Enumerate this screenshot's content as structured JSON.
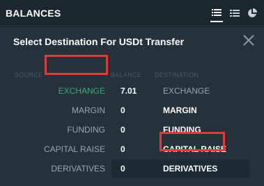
{
  "header": {
    "title": "BALANCES",
    "icons": [
      "list-icon",
      "detailed-list-icon",
      "pie-chart-icon"
    ]
  },
  "modal": {
    "title": "Select Destination For USDt Transfer",
    "close_icon": "close-icon",
    "columns": {
      "source": "SOURCE",
      "balance": "BALANCE",
      "destination": "DESTINATION"
    },
    "rows": [
      {
        "source": "EXCHANGE",
        "balance": "7.01",
        "destination": "EXCHANGE",
        "source_selected": true,
        "destination_enabled": false
      },
      {
        "source": "MARGIN",
        "balance": "0",
        "destination": "MARGIN",
        "source_selected": false,
        "destination_enabled": true
      },
      {
        "source": "FUNDING",
        "balance": "0",
        "destination": "FUNDING",
        "source_selected": false,
        "destination_enabled": true
      },
      {
        "source": "CAPITAL RAISE",
        "balance": "0",
        "destination": "CAPITAL RAISE",
        "source_selected": false,
        "destination_enabled": true
      },
      {
        "source": "DERIVATIVES",
        "balance": "0",
        "destination": "DERIVATIVES",
        "source_selected": false,
        "destination_enabled": true,
        "hovered": true
      }
    ]
  },
  "colors": {
    "background": "#1b262d",
    "modal_background": "#26323a",
    "selected_source": "#3fa77a",
    "highlight_box": "#e13a3a"
  }
}
